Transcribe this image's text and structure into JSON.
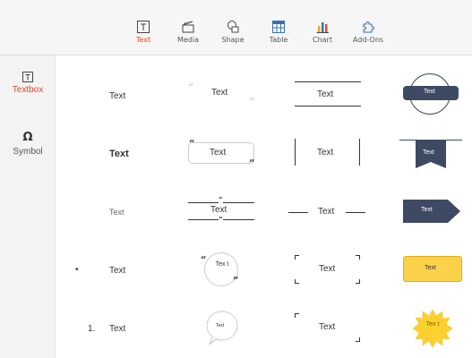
{
  "toolbar": {
    "items": [
      {
        "label": "Text",
        "icon": "text-icon",
        "active": true
      },
      {
        "label": "Media",
        "icon": "media-icon",
        "active": false
      },
      {
        "label": "Shape",
        "icon": "shape-icon",
        "active": false
      },
      {
        "label": "Table",
        "icon": "table-icon",
        "active": false
      },
      {
        "label": "Chart",
        "icon": "chart-icon",
        "active": false
      },
      {
        "label": "Add-Ons",
        "icon": "puzzle-icon",
        "active": false
      }
    ]
  },
  "sidebar": {
    "items": [
      {
        "label": "Textbox",
        "icon": "textbox-icon",
        "active": true
      },
      {
        "label": "Symbol",
        "icon": "omega-icon",
        "glyph": "Ω",
        "active": false
      }
    ]
  },
  "colors": {
    "accent": "#e8452c",
    "navy": "#3e4a63",
    "yellow": "#fcd24a",
    "yellow_border": "#e9a91c",
    "burst": "#fcd12f"
  },
  "styles": {
    "plain": "Text",
    "bold": "Text",
    "light": "Text",
    "bullet_marker": "•",
    "bullet": "Text",
    "numbered_marker": "1.",
    "numbered": "Text",
    "quote_plain": "Text",
    "quote_box": "Text",
    "quote_lines": "Text",
    "quote_circle": "Tex t",
    "speech_bubble": "Text",
    "lines_top_bottom": "Text",
    "bars_left_right": "Text",
    "lines_side": "Text",
    "brackets_corners": "Text",
    "brackets_half": "Text",
    "banner_circle": "Text",
    "ribbon": "Text",
    "arrow": "Text",
    "yellow_box": "Text",
    "burst": "Tex t"
  }
}
